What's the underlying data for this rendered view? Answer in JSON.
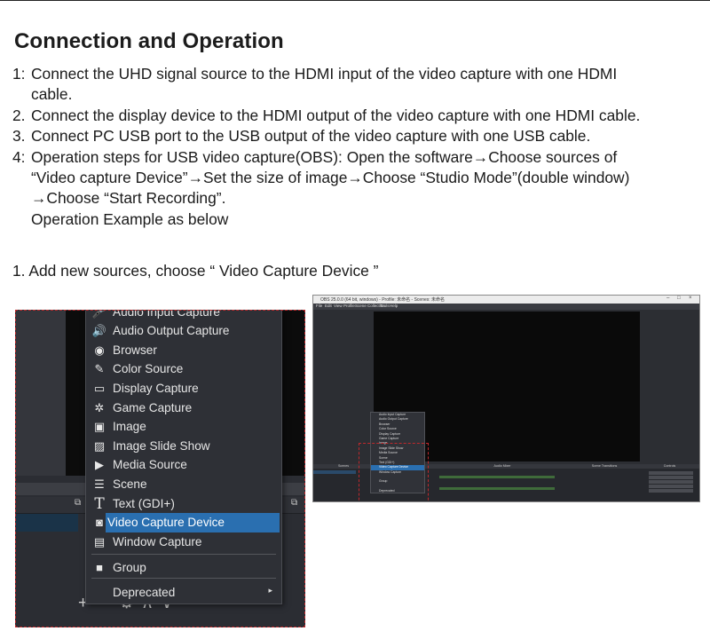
{
  "heading": "Connection and Operation",
  "steps": [
    {
      "num": "1:",
      "lines": [
        "Connect the UHD signal source to the HDMI input of the video capture with one HDMI",
        "cable."
      ]
    },
    {
      "num": "2.",
      "lines": [
        "Connect the display device to the HDMI output of the video capture with one HDMI cable."
      ]
    },
    {
      "num": "3.",
      "lines": [
        "Connect PC USB port to the USB output of the video capture with one USB cable."
      ]
    },
    {
      "num": "4:",
      "lines": [
        "Operation steps for USB video capture(OBS): Open the software→Choose sources of",
        "“Video capture Device”→Set the size of image→Choose “Studio Mode”(double window)",
        "→Choose “Start Recording”.",
        "Operation Example as below"
      ]
    }
  ],
  "subheading": "1. Add new sources, choose “ Video Capture Device ”",
  "zoom_menu": {
    "items": [
      {
        "label": "Audio Input Capture",
        "icon": "microphone-icon",
        "glyph": "🎤"
      },
      {
        "label": "Audio Output Capture",
        "icon": "speaker-icon",
        "glyph": "🔊"
      },
      {
        "label": "Browser",
        "icon": "globe-icon",
        "glyph": "◉"
      },
      {
        "label": "Color Source",
        "icon": "brush-icon",
        "glyph": "✎"
      },
      {
        "label": "Display Capture",
        "icon": "monitor-icon",
        "glyph": "▭"
      },
      {
        "label": "Game Capture",
        "icon": "gamepad-icon",
        "glyph": "✲"
      },
      {
        "label": "Image",
        "icon": "image-icon",
        "glyph": "▣"
      },
      {
        "label": "Image Slide Show",
        "icon": "slideshow-icon",
        "glyph": "▨"
      },
      {
        "label": "Media Source",
        "icon": "play-icon",
        "glyph": "▶"
      },
      {
        "label": "Scene",
        "icon": "list-icon",
        "glyph": "☰"
      },
      {
        "label": "Text (GDI+)",
        "icon": "text-icon",
        "glyph": "T"
      },
      {
        "label": "Video Capture Device",
        "icon": "camera-icon",
        "glyph": "◙"
      },
      {
        "label": "Window Capture",
        "icon": "window-icon",
        "glyph": "▤"
      },
      {
        "label": "Group",
        "icon": "folder-icon",
        "glyph": "■"
      },
      {
        "label": "Deprecated",
        "icon": "",
        "glyph": ""
      }
    ],
    "selected": "Video Capture Device",
    "submenu_arrow": "▸"
  },
  "zoom_bottom_icons": [
    "+",
    "—",
    "⚙",
    "∧",
    "∨"
  ],
  "colors": {
    "selection": "#2a6fb0",
    "dashed_border": "#c0282c",
    "obs_background": "#2b2d33"
  },
  "screenshot": {
    "title": "OBS 25.0.0 (64 bit, windows) - Profile: 未命名 - Scenes: 未命名",
    "menubar": [
      "File",
      "Edit",
      "View",
      "Profile",
      "Scene Collection",
      "Tools",
      "Help"
    ],
    "dock_headers": [
      "Scenes",
      "Sources",
      "Audio Mixer",
      "Scene Transitions",
      "Controls"
    ],
    "controls": [
      "Start Streaming",
      "Start Recording",
      "Studio Mode",
      "Settings",
      "Exit"
    ],
    "mini_menu": [
      "Audio Input Capture",
      "Audio Output Capture",
      "Browser",
      "Color Source",
      "Display Capture",
      "Game Capture",
      "Image",
      "Image Slide Show",
      "Media Source",
      "Scene",
      "Text (GDI+)",
      "Video Capture Device",
      "Window Capture",
      "",
      "Group",
      "",
      "Deprecated"
    ]
  }
}
